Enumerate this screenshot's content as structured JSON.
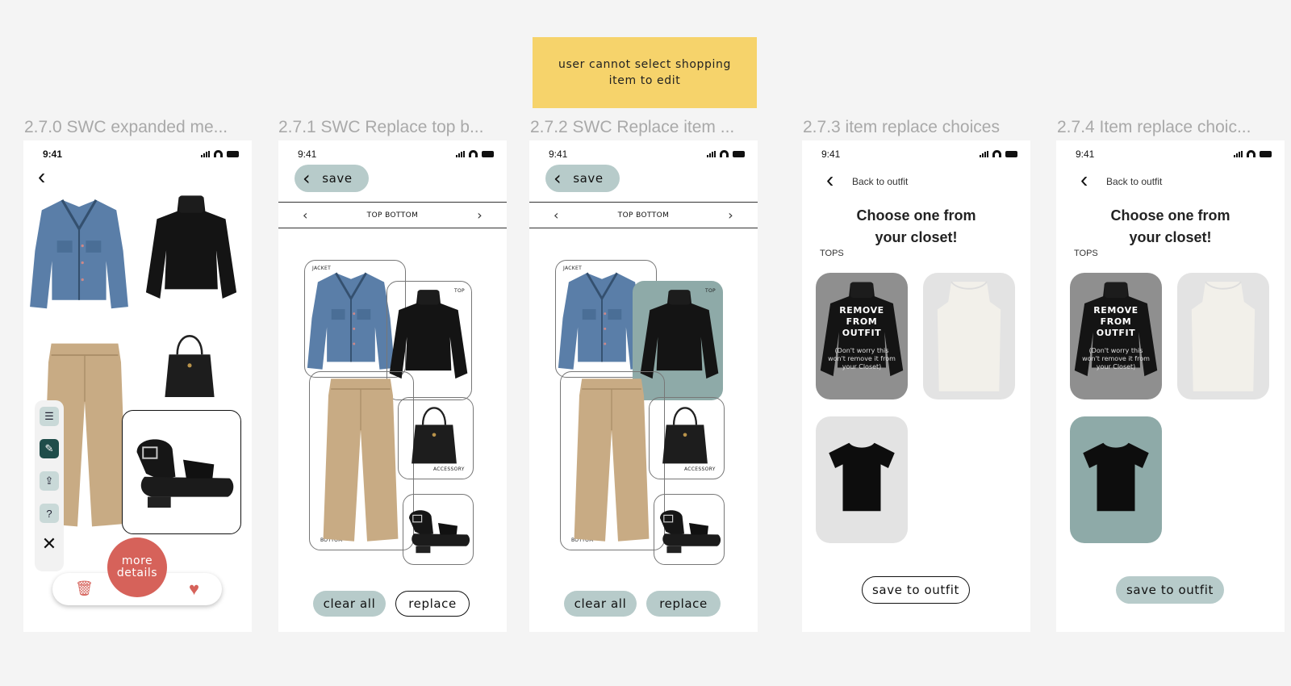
{
  "note": "user cannot select shopping item to edit",
  "frames": [
    {
      "label": "2.7.0 SWC expanded me..."
    },
    {
      "label": "2.7.1 SWC Replace top b..."
    },
    {
      "label": "2.7.2 SWC Replace item ..."
    },
    {
      "label": "2.7.3 item replace choices"
    },
    {
      "label": "2.7.4 Item replace choic..."
    }
  ],
  "status_time": "9:41",
  "outfit_editor": {
    "save": "save",
    "category_bar": "TOP BOTTOM",
    "tags": {
      "jacket": "JACKET",
      "top": "TOP",
      "accessory": "ACCESSORY",
      "bottom": "BOTTOM"
    },
    "clear_all": "clear all",
    "replace": "replace"
  },
  "expanded_menu": {
    "more_details": "more details",
    "tools": [
      "sliders-icon",
      "pencil-icon",
      "share-icon",
      "help-icon",
      "close-icon"
    ]
  },
  "replace_choices": {
    "back_to_outfit": "Back to outfit",
    "heading": "Choose one from your closet!",
    "section": "TOPS",
    "remove_title": "REMOVE FROM OUTFIT",
    "remove_note": "(Don't worry this won't remove it from your Closet)",
    "save_to_outfit": "save to outfit"
  },
  "colors": {
    "sage": "#b7cbca",
    "teal": "#8eaaa8",
    "coral": "#d6625a",
    "note": "#f6d36b"
  }
}
